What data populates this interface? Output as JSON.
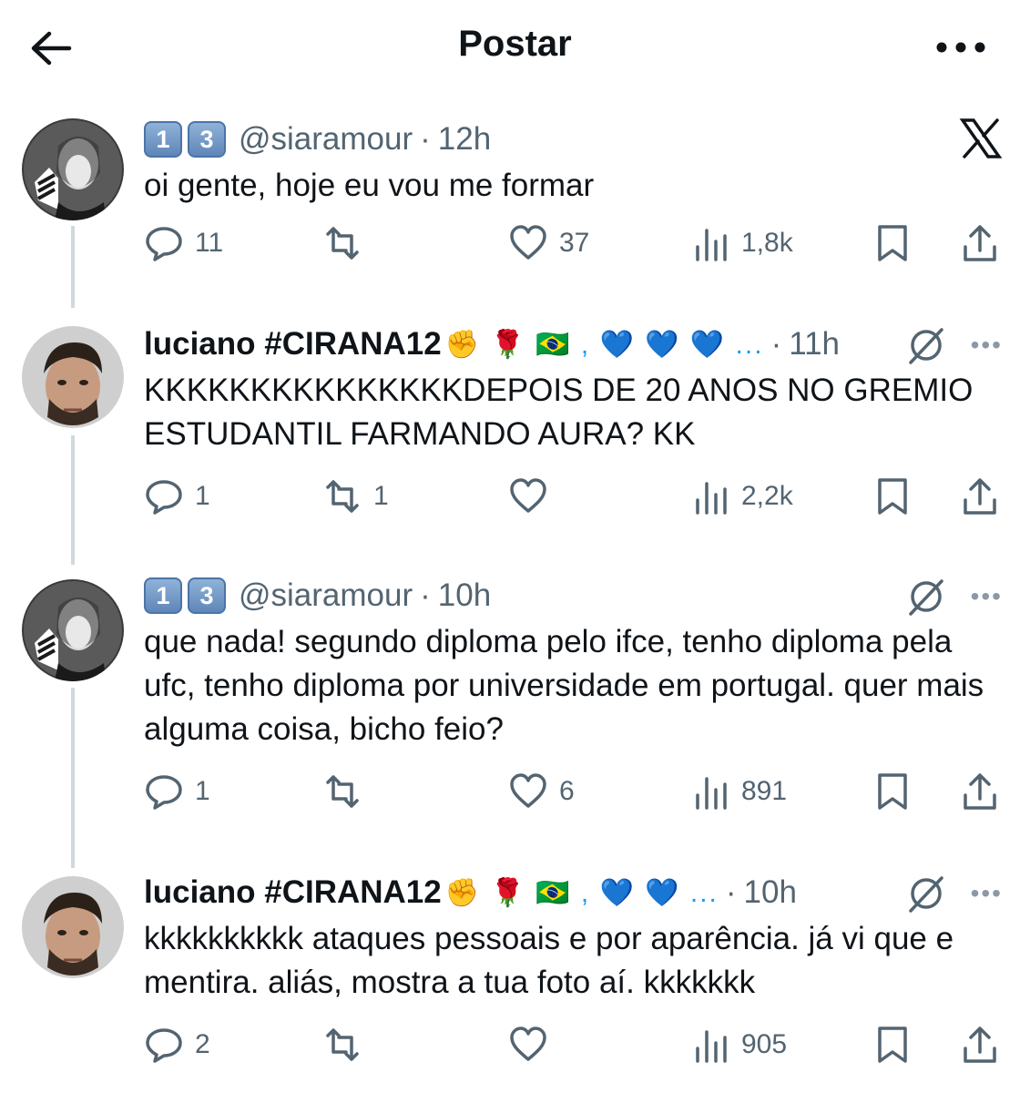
{
  "header": {
    "title": "Postar",
    "back_icon": "arrow-left-icon",
    "more_icon": "more-horizontal-icon"
  },
  "posts": [
    {
      "badges": [
        "1",
        "3"
      ],
      "name": "",
      "emojis": "",
      "handle": "@siaramour",
      "time": "12h",
      "text": "oi gente, hoje eu vou me formar",
      "replies": "11",
      "reposts": "",
      "likes": "37",
      "views": "1,8k"
    },
    {
      "badges": [],
      "name": "luciano #CIRANA12",
      "emojis": "✊ 🌹 🇧🇷 , 💙 💙 💙 ...",
      "handle": "",
      "time": "11h",
      "text": "KKKKKKKKKKKKKKKDEPOIS DE 20 ANOS NO GREMIO ESTUDANTIL FARMANDO AURA? KK",
      "replies": "1",
      "reposts": "1",
      "likes": "",
      "views": "2,2k"
    },
    {
      "badges": [
        "1",
        "3"
      ],
      "name": "",
      "emojis": "",
      "handle": "@siaramour",
      "time": "10h",
      "text": "que nada! segundo diploma pelo ifce, tenho diploma pela ufc, tenho diploma por universidade em portugal. quer mais alguma coisa, bicho feio?",
      "replies": "1",
      "reposts": "",
      "likes": "6",
      "views": "891"
    },
    {
      "badges": [],
      "name": "luciano #CIRANA12",
      "emojis": "✊ 🌹 🇧🇷 , 💙 💙 ...",
      "handle": "",
      "time": "10h",
      "text": "kkkkkkkkkk ataques pessoais e por aparência. já vi que e mentira. aliás, mostra a tua foto aí. kkkkkkk",
      "replies": "2",
      "reposts": "",
      "likes": "",
      "views": "905"
    }
  ],
  "colors": {
    "text": "#0f1419",
    "secondary": "#536471",
    "line": "#cfd9de",
    "badge": "#6f95c4"
  }
}
